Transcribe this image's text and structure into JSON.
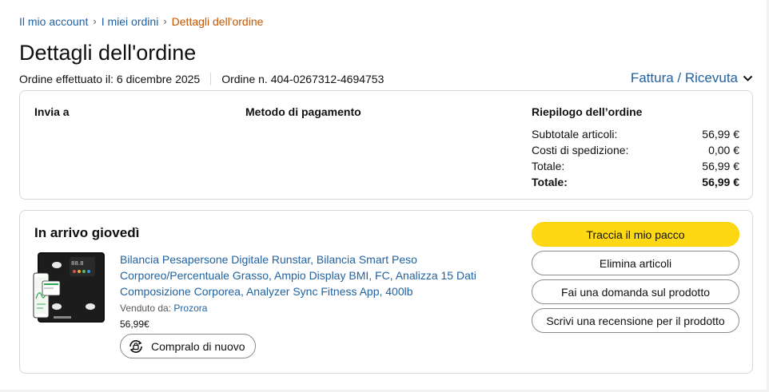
{
  "breadcrumb": {
    "items": [
      "Il mio account",
      "I miei ordini"
    ],
    "current": "Dettagli dell'ordine",
    "separator": "›"
  },
  "page_title": "Dettagli dell'ordine",
  "order_meta": {
    "placed": "Ordine effettuato il: 6 dicembre 2025",
    "number": "Ordine n. 404-0267312-4694753"
  },
  "invoice_link": "Fattura / Ricevuta",
  "summary_box": {
    "ship_to": "Invia a",
    "payment_method": "Metodo di pagamento",
    "order_summary": "Riepilogo dell’ordine",
    "rows": [
      {
        "label": "Subtotale articoli:",
        "value": "56,99 €"
      },
      {
        "label": "Costi di spedizione:",
        "value": "0,00 €"
      },
      {
        "label": "Totale:",
        "value": "56,99 €"
      },
      {
        "label": "Totale:",
        "value": "56,99 €"
      }
    ]
  },
  "shipment": {
    "status": "In arrivo giovedì",
    "product_title": "Bilancia Pesapersone Digitale Runstar, Bilancia Smart Peso Corporeo/Percentuale Grasso, Ampio Display BMI, FC, Analizza 15 Dati Composizione Corporea, Analyzer Sync Fitness App, 400lb",
    "sold_by_label": "Venduto da:",
    "seller": "Prozora",
    "price": "56,99€",
    "buy_again": "Compralo di nuovo",
    "buttons": {
      "track": "Traccia il mio pacco",
      "delete": "Elimina articoli",
      "question": "Fai una domanda sul prodotto",
      "review": "Scrivi una recensione per il prodotto"
    }
  },
  "colors": {
    "link": "#2162a1",
    "breadcrumb_current": "#c45500",
    "primary_button": "#ffd814",
    "border": "#d5d9d9"
  },
  "icons": [
    "chevron-down-icon",
    "buy-again-icon",
    "product-image"
  ]
}
